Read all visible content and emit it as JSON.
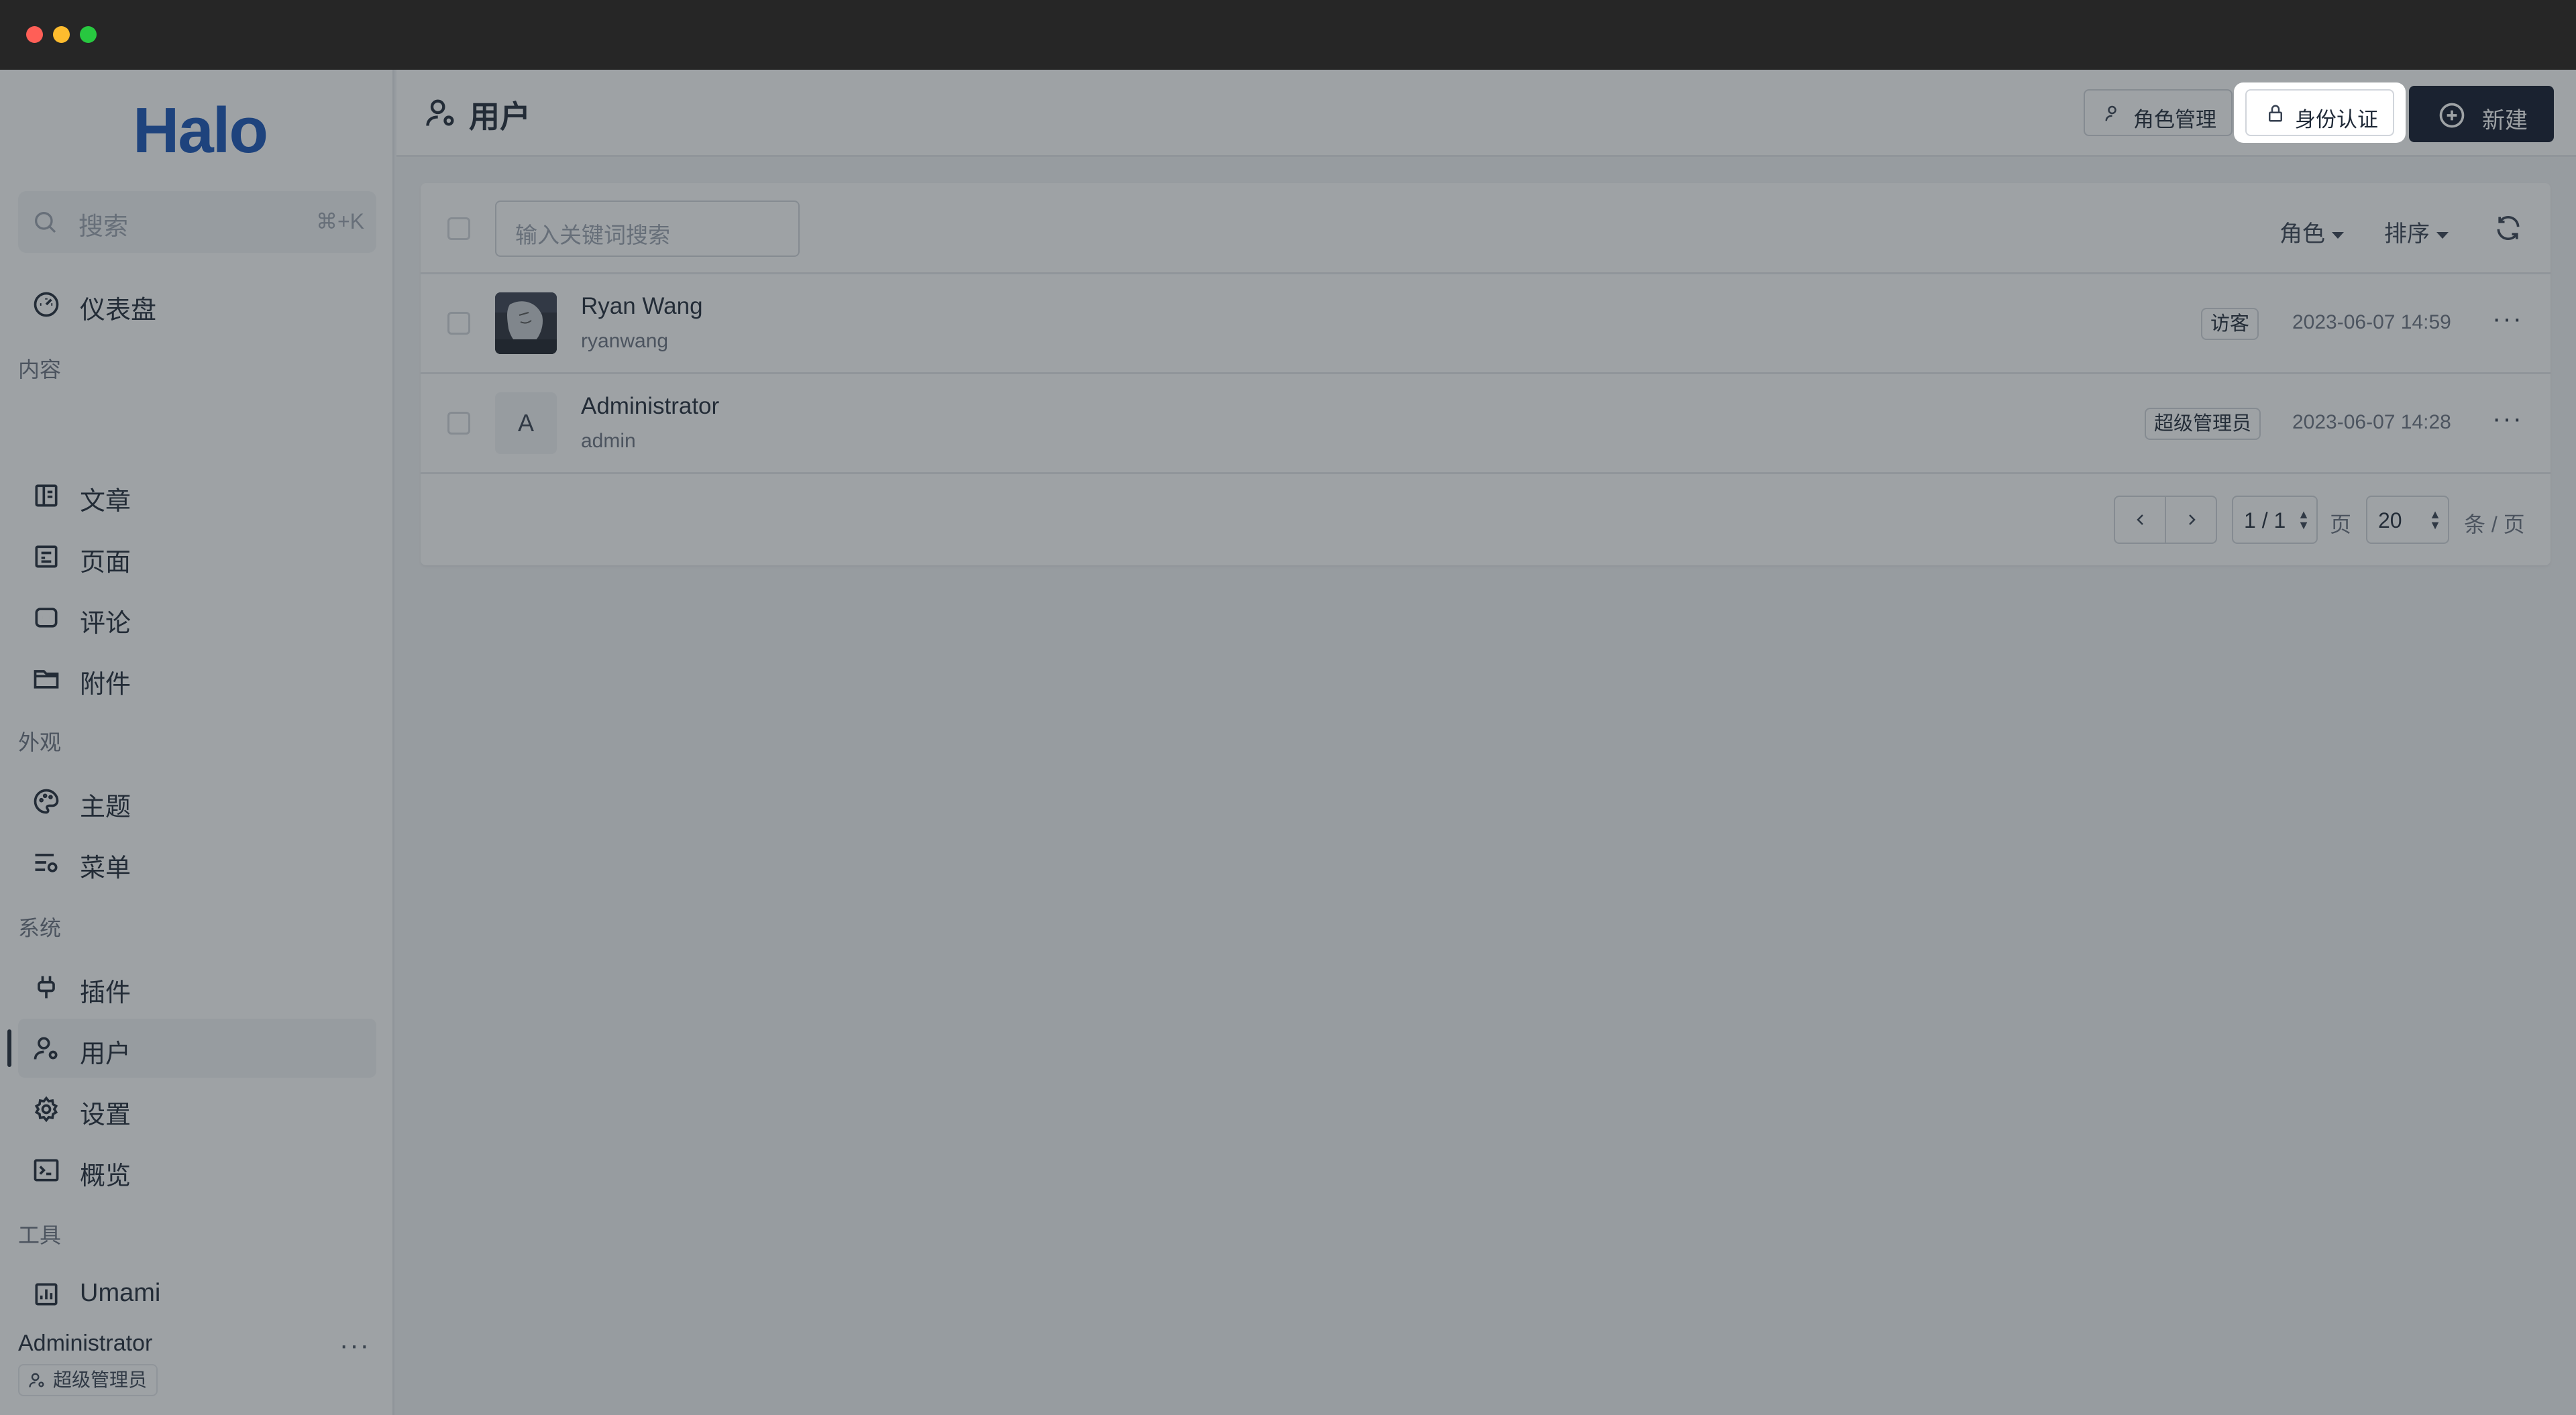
{
  "sidebar": {
    "logo": "Halo",
    "search_placeholder": "搜索",
    "search_shortcut": "⌘+K",
    "dashboard": "仪表盘",
    "groups": {
      "content": "内容",
      "appearance": "外观",
      "system": "系统",
      "tools": "工具"
    },
    "items": {
      "posts": "文章",
      "pages": "页面",
      "comments": "评论",
      "attachments": "附件",
      "themes": "主题",
      "menus": "菜单",
      "plugins": "插件",
      "users": "用户",
      "settings": "设置",
      "overview": "概览",
      "umami": "Umami"
    },
    "current_user": {
      "name": "Administrator",
      "role": "超级管理员"
    }
  },
  "header": {
    "title": "用户",
    "role_button": "角色管理",
    "auth_button": "身份认证",
    "new_button": "新建"
  },
  "toolbar": {
    "search_placeholder": "输入关键词搜索",
    "role_filter": "角色",
    "sort_filter": "排序"
  },
  "users": [
    {
      "display_name": "Ryan Wang",
      "username": "ryanwang",
      "role": "访客",
      "created": "2023-06-07 14:59",
      "avatar_letter": ""
    },
    {
      "display_name": "Administrator",
      "username": "admin",
      "role": "超级管理员",
      "created": "2023-06-07 14:28",
      "avatar_letter": "A"
    }
  ],
  "pagination": {
    "page_value": "1 / 1",
    "page_unit": "页",
    "size_value": "20",
    "size_unit": "条 / 页"
  },
  "colors": {
    "brand": "#1653b7",
    "primary_button": "#0f172a"
  }
}
